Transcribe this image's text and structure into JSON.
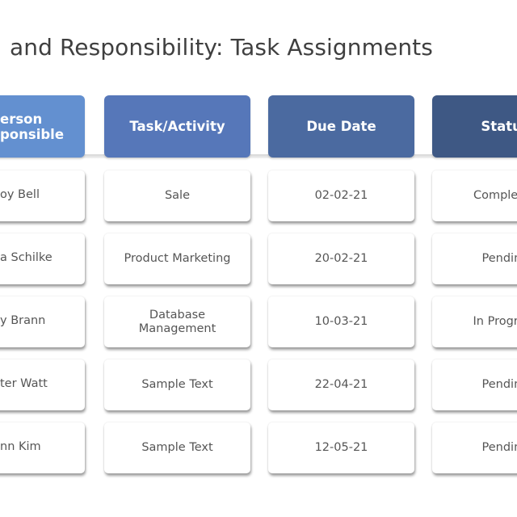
{
  "title": "and Responsibility: Task Assignments",
  "colors": {
    "header_1": "#6390d0",
    "header_2": "#5677b9",
    "header_3": "#4b6aa0",
    "header_4": "#3e5884",
    "cell_text": "#555555",
    "title_text": "#3f3f3f"
  },
  "headers": [
    {
      "line1": "erson",
      "line2": "ponsible"
    },
    {
      "label": "Task/Activity"
    },
    {
      "label": "Due Date"
    },
    {
      "label": "Status"
    }
  ],
  "rows": [
    {
      "person": "oy Bell",
      "task": "Sale",
      "due_date": "02-02-21",
      "status": "Completed"
    },
    {
      "person": "a Schilke",
      "task": "Product Marketing",
      "due_date": "20-02-21",
      "status": "Pending"
    },
    {
      "person": "y Brann",
      "task": "Database Management",
      "due_date": "10-03-21",
      "status": "In Progress"
    },
    {
      "person": "ter Watt",
      "task": "Sample Text",
      "due_date": "22-04-21",
      "status": "Pending"
    },
    {
      "person": "nn Kim",
      "task": "Sample Text",
      "due_date": "12-05-21",
      "status": "Pending"
    }
  ]
}
